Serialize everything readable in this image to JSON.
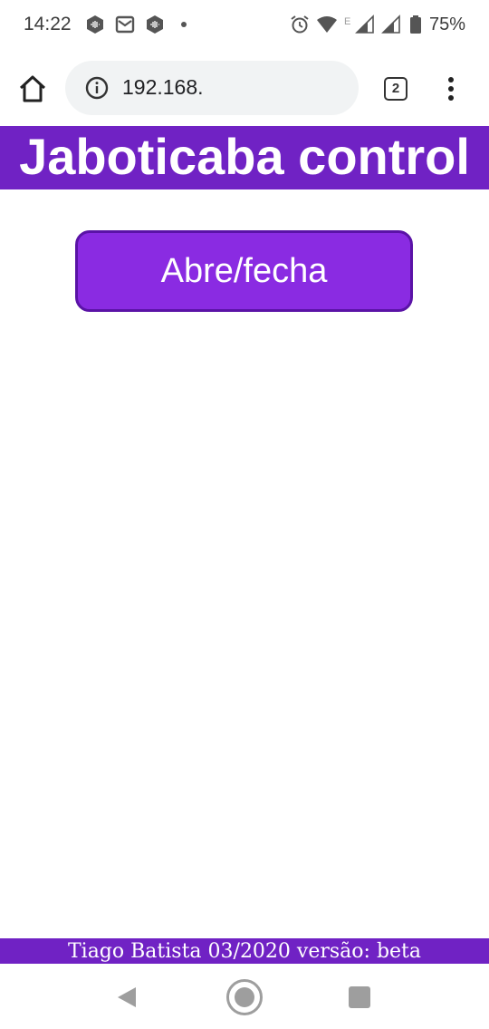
{
  "status_bar": {
    "time": "14:22",
    "battery_percent": "75%",
    "icons": [
      "signal-app-icon",
      "gmail-icon",
      "signal-app-icon",
      "dot-icon",
      "alarm-icon",
      "wifi-icon",
      "cell-signal-icon",
      "cell-signal-icon",
      "battery-icon"
    ]
  },
  "browser": {
    "url": "192.168.",
    "tab_count": "2"
  },
  "page": {
    "title": "Jaboticaba control",
    "toggle_button_label": "Abre/fecha",
    "footer_text": "Tiago Batista 03/2020 versão: beta"
  },
  "colors": {
    "header_bg": "#7022c4",
    "button_bg": "#8a2be2",
    "button_border": "#5a13a6"
  },
  "nav_bar": {
    "icons": [
      "back-icon",
      "home-icon",
      "recents-icon"
    ]
  }
}
